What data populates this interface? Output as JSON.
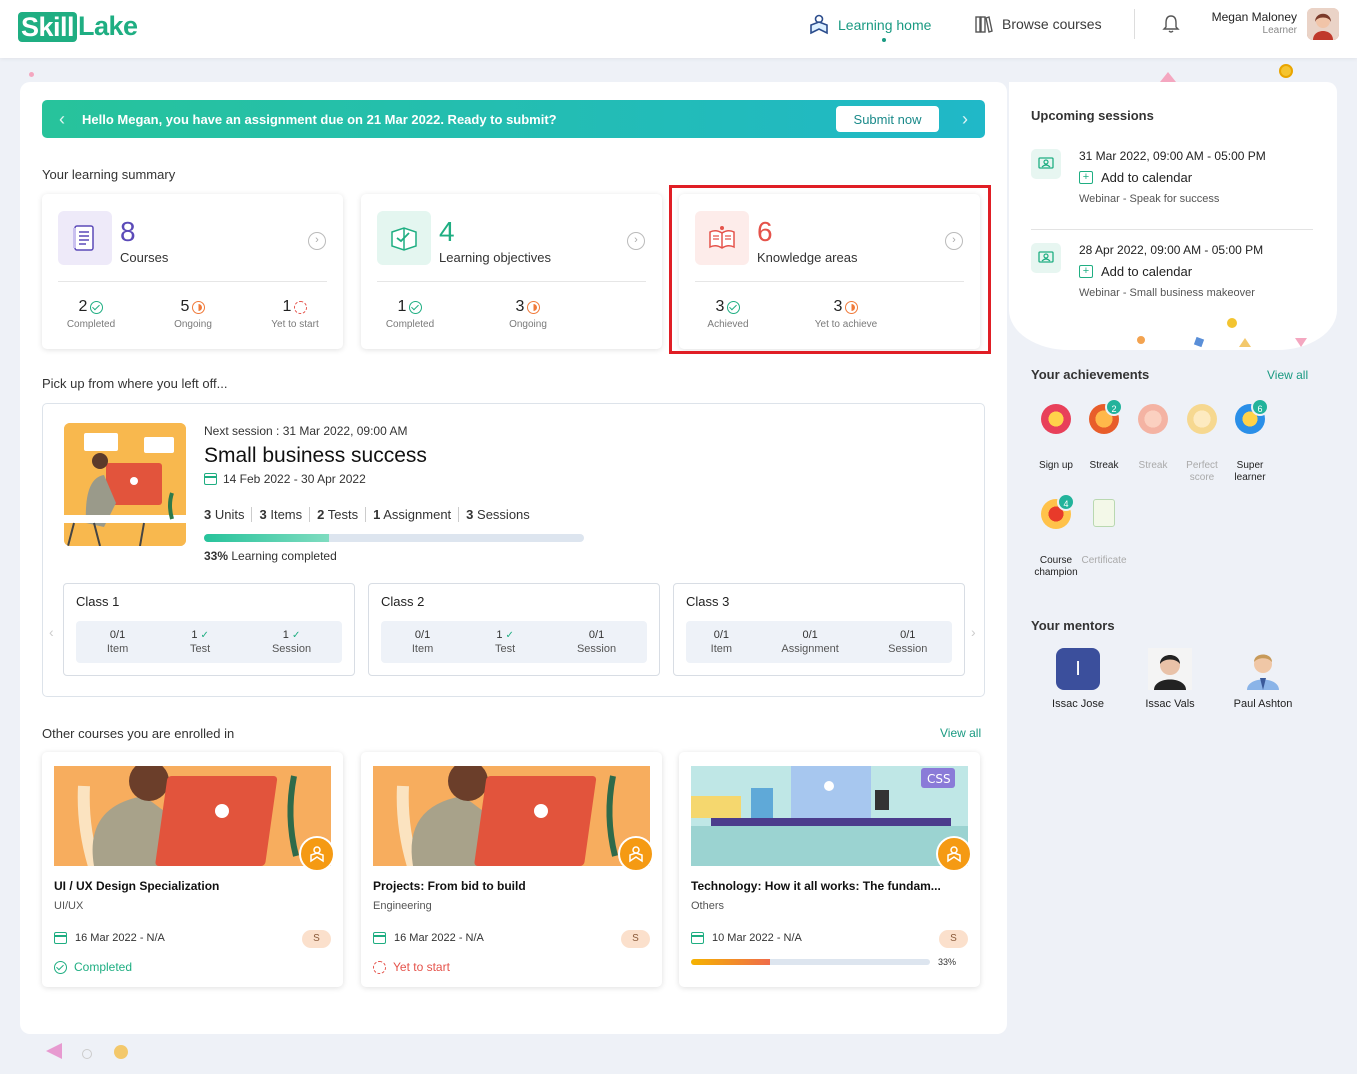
{
  "brand": {
    "logo_part1": "Skill",
    "logo_part2": "Lake"
  },
  "nav": {
    "learning_home": "Learning home",
    "browse_courses": "Browse courses"
  },
  "user": {
    "name": "Megan Maloney",
    "role": "Learner"
  },
  "banner": {
    "message": "Hello Megan, you have an assignment due on 21 Mar 2022. Ready to submit?",
    "button": "Submit now"
  },
  "summary": {
    "title": "Your learning summary",
    "cards": [
      {
        "count": "8",
        "label": "Courses",
        "count_color": "#5b4ab8",
        "stats": [
          {
            "n": "2",
            "l": "Completed"
          },
          {
            "n": "5",
            "l": "Ongoing"
          },
          {
            "n": "1",
            "l": "Yet to start"
          }
        ]
      },
      {
        "count": "4",
        "label": "Learning objectives",
        "count_color": "#1fae82",
        "stats": [
          {
            "n": "1",
            "l": "Completed"
          },
          {
            "n": "3",
            "l": "Ongoing"
          }
        ]
      },
      {
        "count": "6",
        "label": "Knowledge areas",
        "count_color": "#e5534b",
        "stats": [
          {
            "n": "3",
            "l": "Achieved"
          },
          {
            "n": "3",
            "l": "Yet to achieve"
          }
        ]
      }
    ]
  },
  "continue": {
    "title": "Pick up from where you left off...",
    "next_session": "Next session : 31 Mar 2022, 09:00 AM",
    "course_title": "Small business success",
    "dates": "14 Feb 2022 - 30 Apr 2022",
    "meta": [
      {
        "n": "3",
        "l": "Units"
      },
      {
        "n": "3",
        "l": "Items"
      },
      {
        "n": "2",
        "l": "Tests"
      },
      {
        "n": "1",
        "l": "Assignment"
      },
      {
        "n": "3",
        "l": "Sessions"
      }
    ],
    "progress": 0.33,
    "progress_pct": "33%",
    "progress_label": "Learning completed",
    "classes": [
      {
        "name": "Class 1",
        "items": [
          {
            "v": "0/1",
            "l": "Item",
            "tick": false
          },
          {
            "v": "1",
            "l": "Test",
            "tick": true
          },
          {
            "v": "1",
            "l": "Session",
            "tick": true
          }
        ]
      },
      {
        "name": "Class 2",
        "items": [
          {
            "v": "0/1",
            "l": "Item",
            "tick": false
          },
          {
            "v": "1",
            "l": "Test",
            "tick": true
          },
          {
            "v": "0/1",
            "l": "Session",
            "tick": false
          }
        ]
      },
      {
        "name": "Class 3",
        "items": [
          {
            "v": "0/1",
            "l": "Item",
            "tick": false
          },
          {
            "v": "0/1",
            "l": "Assignment",
            "tick": false
          },
          {
            "v": "0/1",
            "l": "Session",
            "tick": false
          }
        ]
      }
    ]
  },
  "enrolled": {
    "title": "Other courses you are enrolled in",
    "view_all": "View all",
    "courses": [
      {
        "title": "UI / UX Design Specialization",
        "category": "UI/UX",
        "date": "16 Mar 2022 - N/A",
        "badge": "S",
        "status": "Completed",
        "status_color": "#1fae82"
      },
      {
        "title": "Projects: From bid to build",
        "category": "Engineering",
        "date": "16 Mar 2022 - N/A",
        "badge": "S",
        "status": "Yet to start",
        "status_color": "#e5534b"
      },
      {
        "title": "Technology: How it all works: The fundam...",
        "category": "Others",
        "date": "10 Mar 2022 - N/A",
        "badge": "S",
        "progress": 0.33,
        "progress_pct": "33%",
        "img_tag": "CSS"
      }
    ]
  },
  "sessions": {
    "title": "Upcoming sessions",
    "items": [
      {
        "time": "31 Mar 2022, 09:00 AM - 05:00 PM",
        "add": "Add to calendar",
        "desc": "Webinar - Speak for success"
      },
      {
        "time": "28 Apr 2022, 09:00 AM - 05:00 PM",
        "add": "Add to calendar",
        "desc": "Webinar - Small business makeover"
      }
    ]
  },
  "achievements": {
    "title": "Your achievements",
    "view_all": "View all",
    "items": [
      {
        "label": "Sign up",
        "count": "",
        "active": true
      },
      {
        "label": "Streak",
        "count": "2",
        "active": true
      },
      {
        "label": "Streak",
        "count": "",
        "active": false
      },
      {
        "label": "Perfect score",
        "count": "",
        "active": false
      },
      {
        "label": "Super learner",
        "count": "6",
        "active": true
      },
      {
        "label": "Course champion",
        "count": "4",
        "active": true
      },
      {
        "label": "Certificate",
        "count": "",
        "active": false
      }
    ]
  },
  "mentors": {
    "title": "Your mentors",
    "items": [
      {
        "name": "Issac Jose",
        "initial": "I"
      },
      {
        "name": "Issac Vals",
        "initial": ""
      },
      {
        "name": "Paul Ashton",
        "initial": ""
      }
    ]
  }
}
